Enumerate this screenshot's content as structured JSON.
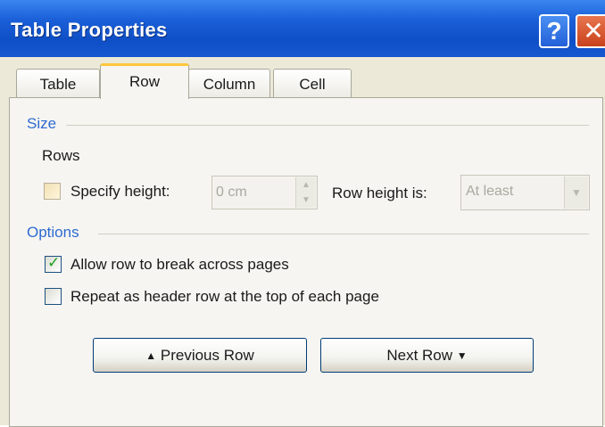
{
  "window": {
    "title": "Table Properties"
  },
  "titlebar": {
    "help_glyph": "?",
    "close_glyph": "✕"
  },
  "tabs": [
    {
      "label": "Table",
      "active": false
    },
    {
      "label": "Row",
      "active": true
    },
    {
      "label": "Column",
      "active": false
    },
    {
      "label": "Cell",
      "active": false
    }
  ],
  "size_section": {
    "heading": "Size",
    "rows_label": "Rows",
    "specify_height": {
      "label": "Specify height:",
      "checked": false,
      "enabled": true
    },
    "height_value": "0 cm",
    "row_height_is_label": "Row height is:",
    "row_height_is_value": "At least"
  },
  "options_section": {
    "heading": "Options",
    "allow_break": {
      "label": "Allow row to break across pages",
      "checked": true
    },
    "repeat_header": {
      "label": "Repeat as header row at the top of each page",
      "checked": false
    }
  },
  "buttons": {
    "previous_row": "Previous Row",
    "next_row": "Next Row",
    "up_arrow": "▲",
    "down_arrow": "▼"
  },
  "colors": {
    "titlebar": "#1a5fd8",
    "section_heading": "#2d6bd0",
    "active_tab_accent": "#ffc73c",
    "checkmark": "#21a121"
  },
  "icons": [
    "help-icon",
    "close-icon",
    "spin-up-icon",
    "spin-down-icon",
    "dropdown-arrow-icon",
    "up-arrow-icon",
    "down-arrow-icon",
    "checkmark-icon"
  ]
}
